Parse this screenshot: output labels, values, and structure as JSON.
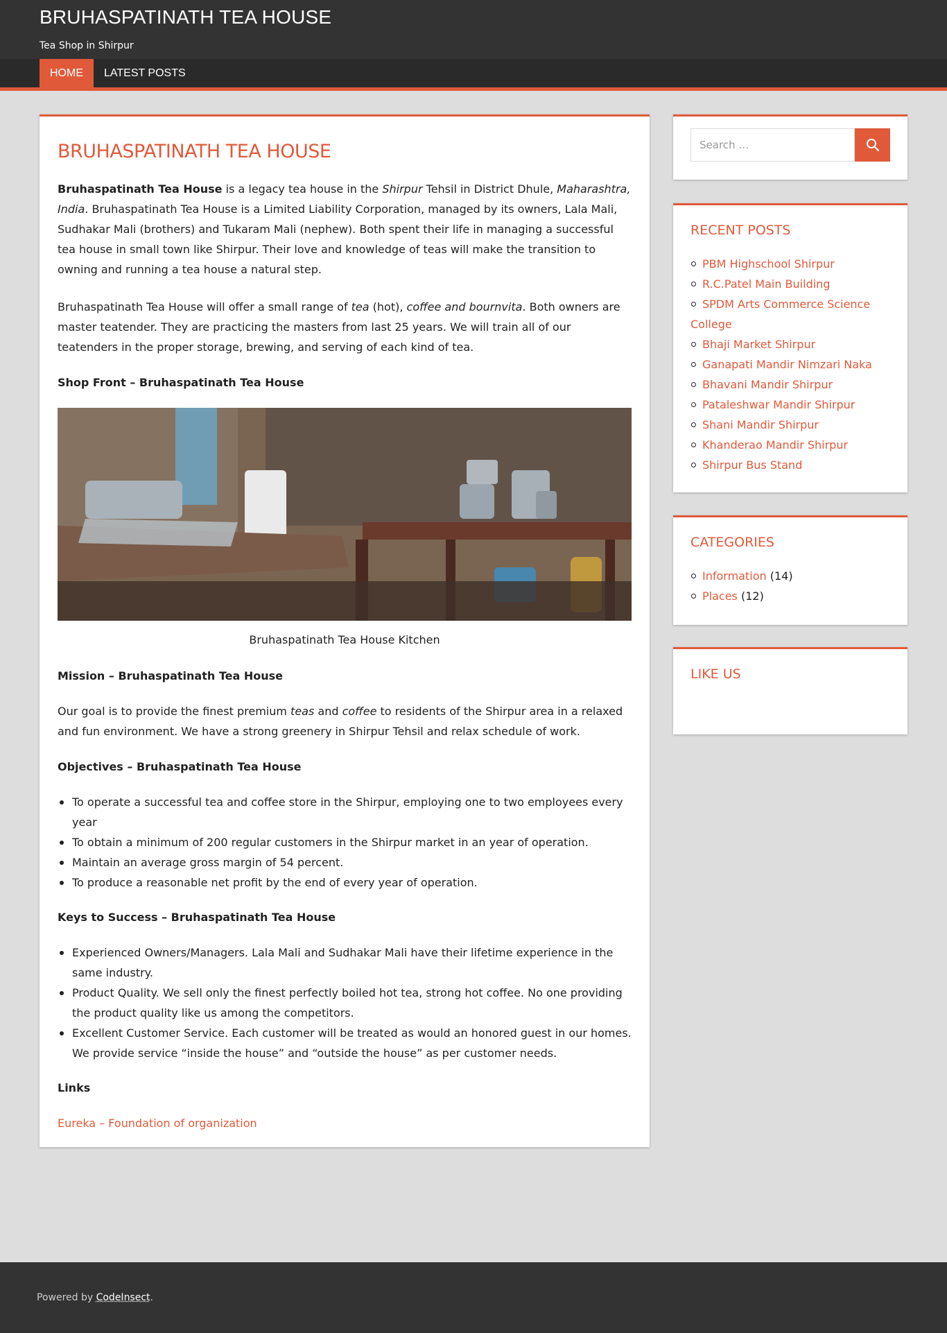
{
  "header": {
    "site_title": "BRUHASPATINATH TEA HOUSE",
    "site_description": "Tea Shop in Shirpur"
  },
  "nav": {
    "items": [
      {
        "label": "HOME",
        "active": true
      },
      {
        "label": "LATEST POSTS",
        "active": false
      }
    ]
  },
  "article": {
    "title": "BRUHASPATINATH TEA HOUSE",
    "intro": {
      "bold_name": "Bruhaspatinath Tea House",
      "t1": " is a legacy tea house in the ",
      "em1": "Shirpur",
      "t2": " Tehsil in District Dhule, ",
      "em2": "Maharashtra, India",
      "t3": ". Bruhaspatinath Tea House is a Limited Liability Corporation, managed by its owners, Lala Mali, Sudhakar Mali (brothers) and Tukaram Mali (nephew). Both spent their life in managing a successful tea house in small town like Shirpur. Their love and knowledge of teas will make the transition to owning and running a tea house a natural step."
    },
    "offer": {
      "t1": "Bruhaspatinath Tea House will offer a small range of ",
      "em1": "tea",
      "t2": " (hot), ",
      "em2": "coffee and bournvita",
      "t3": ". Both owners are master teatender. They are practicing the masters from last 25 years. We will train all of our teatenders in the proper storage, brewing, and serving of each kind of tea."
    },
    "shop_front_heading": "Shop Front – Bruhaspatinath Tea House",
    "image_caption": "Bruhaspatinath Tea House Kitchen",
    "mission_heading": "Mission – Bruhaspatinath Tea House",
    "mission": {
      "t1": "Our goal is to provide the finest premium ",
      "em1": "teas",
      "t2": " and ",
      "em2": "coffee",
      "t3": " to residents of the Shirpur area in a relaxed and fun environment. We have a strong greenery in Shirpur Tehsil and relax schedule of work."
    },
    "objectives_heading": "Objectives – Bruhaspatinath Tea House",
    "objectives": [
      "To  operate a successful tea and coffee store in the Shirpur, employing one to two employees every year",
      "To obtain a minimum of 200 regular customers in the Shirpur market in an year of operation.",
      "Maintain an average gross margin of 54 percent.",
      "To produce a reasonable net profit by the end of every year of operation."
    ],
    "keys_heading": "Keys to Success – Bruhaspatinath Tea House",
    "keys": [
      "Experienced Owners/Managers. Lala Mali and Sudhakar Mali have their lifetime experience in the same industry.",
      "Product Quality. We sell only the finest perfectly boiled hot tea, strong hot coffee. No one providing the product quality like us among the competitors.",
      "Excellent Customer Service. Each customer will be treated as would an honored guest in our homes. We provide service “inside the house” and “outside the house” as per customer needs."
    ],
    "links_heading": "Links",
    "link_label": "Eureka – Foundation of organization"
  },
  "sidebar": {
    "search_placeholder": "Search …",
    "search_icon": "search-icon",
    "recent_posts_title": "RECENT POSTS",
    "recent_posts": [
      "PBM Highschool Shirpur",
      "R.C.Patel Main Building",
      "SPDM Arts Commerce Science College",
      "Bhaji Market Shirpur",
      "Ganapati Mandir Nimzari Naka",
      "Bhavani Mandir Shirpur",
      "Pataleshwar Mandir Shirpur",
      "Shani Mandir Shirpur",
      "Khanderao Mandir Shirpur",
      "Shirpur Bus Stand"
    ],
    "categories_title": "CATEGORIES",
    "categories": [
      {
        "name": "Information",
        "count": "(14)"
      },
      {
        "name": "Places",
        "count": "(12)"
      }
    ],
    "like_us_title": "LIKE US"
  },
  "footer": {
    "prefix": "Powered by ",
    "link": "CodeInsect",
    "suffix": "."
  },
  "colors": {
    "accent": "#e05a3a",
    "header_bg": "#333333",
    "page_bg": "#dddddd"
  }
}
